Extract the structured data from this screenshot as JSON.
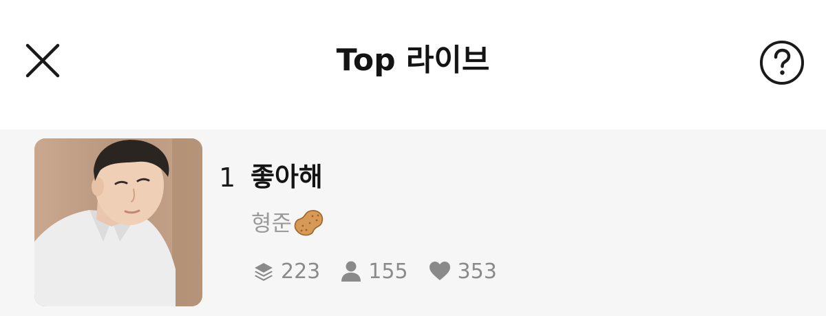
{
  "header": {
    "title": "Top 라이브",
    "close_icon": "close-icon",
    "help_icon": "question-circle-icon"
  },
  "list": {
    "items": [
      {
        "rank": "1",
        "title": "좋아해",
        "artist": "형준",
        "artist_emoji": "peanut-icon",
        "stats": {
          "tracks": "223",
          "listeners": "155",
          "likes": "353"
        }
      }
    ]
  },
  "colors": {
    "background": "#ffffff",
    "list_background": "#f6f6f6",
    "title_text": "#141414",
    "secondary_text": "#9a9a9a",
    "stat_text": "#8a8a8a"
  }
}
